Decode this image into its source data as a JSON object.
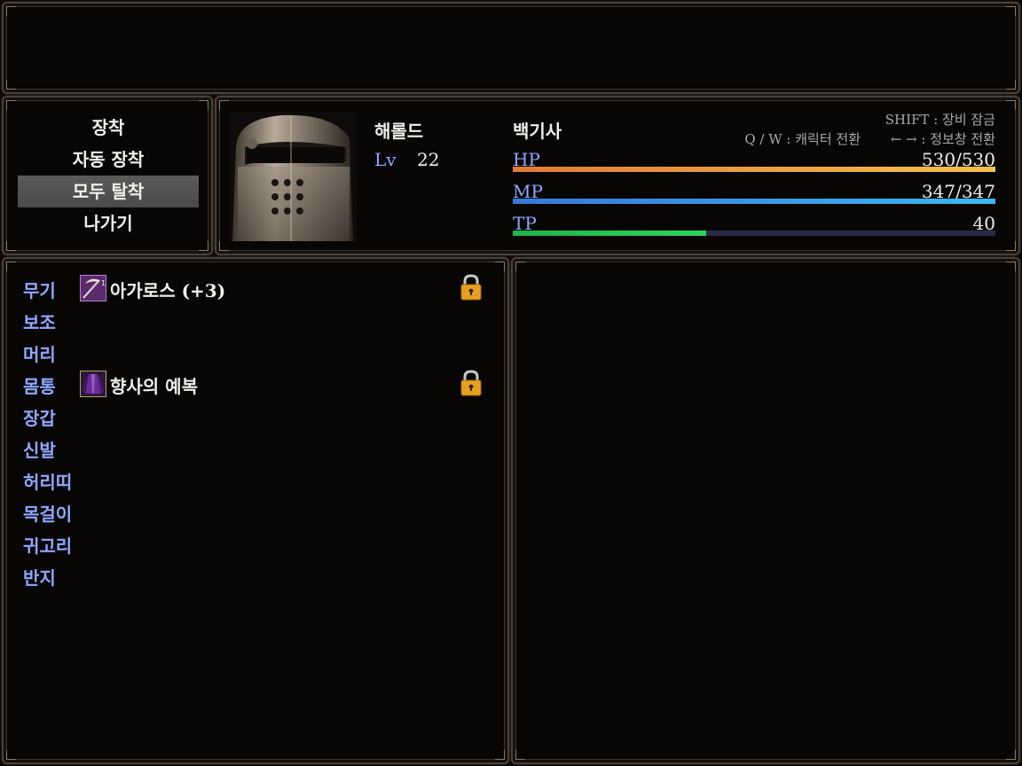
{
  "commands": [
    "장착",
    "자동 장착",
    "모두 탈착",
    "나가기"
  ],
  "selected_command_index": 2,
  "actor": {
    "name": "해롤드",
    "level_label": "Lv",
    "level": "22",
    "class": "백기사"
  },
  "hints": {
    "lock": "SHIFT : 장비 잠금",
    "switch_character": "Q / W : 캐릭터 전환",
    "switch_info": "← → : 정보창 전환"
  },
  "gauges": {
    "hp": {
      "label": "HP",
      "text": "530/530",
      "ratio": 1.0,
      "color_start": "#e07a3a",
      "color_end": "#f2c24a"
    },
    "mp": {
      "label": "MP",
      "text": "347/347",
      "ratio": 1.0,
      "color_start": "#3a78d8",
      "color_end": "#3ab8f0"
    },
    "tp": {
      "label": "TP",
      "text": "40",
      "ratio": 0.4,
      "color_start": "#22b24a",
      "color_end": "#28d85a"
    }
  },
  "slots": [
    {
      "label": "무기",
      "item": "아가로스 (+3)",
      "icon": "scythe-icon",
      "locked": true
    },
    {
      "label": "보조",
      "item": ""
    },
    {
      "label": "머리",
      "item": ""
    },
    {
      "label": "몸통",
      "item": "향사의 예복",
      "icon": "robe-icon",
      "locked": true
    },
    {
      "label": "장갑",
      "item": ""
    },
    {
      "label": "신발",
      "item": ""
    },
    {
      "label": "허리띠",
      "item": ""
    },
    {
      "label": "목걸이",
      "item": ""
    },
    {
      "label": "귀고리",
      "item": ""
    },
    {
      "label": "반지",
      "item": ""
    }
  ],
  "colors": {
    "system_blue": "#8ea8ff",
    "selected_bg": "#555555",
    "window_border": "#4a4038"
  }
}
